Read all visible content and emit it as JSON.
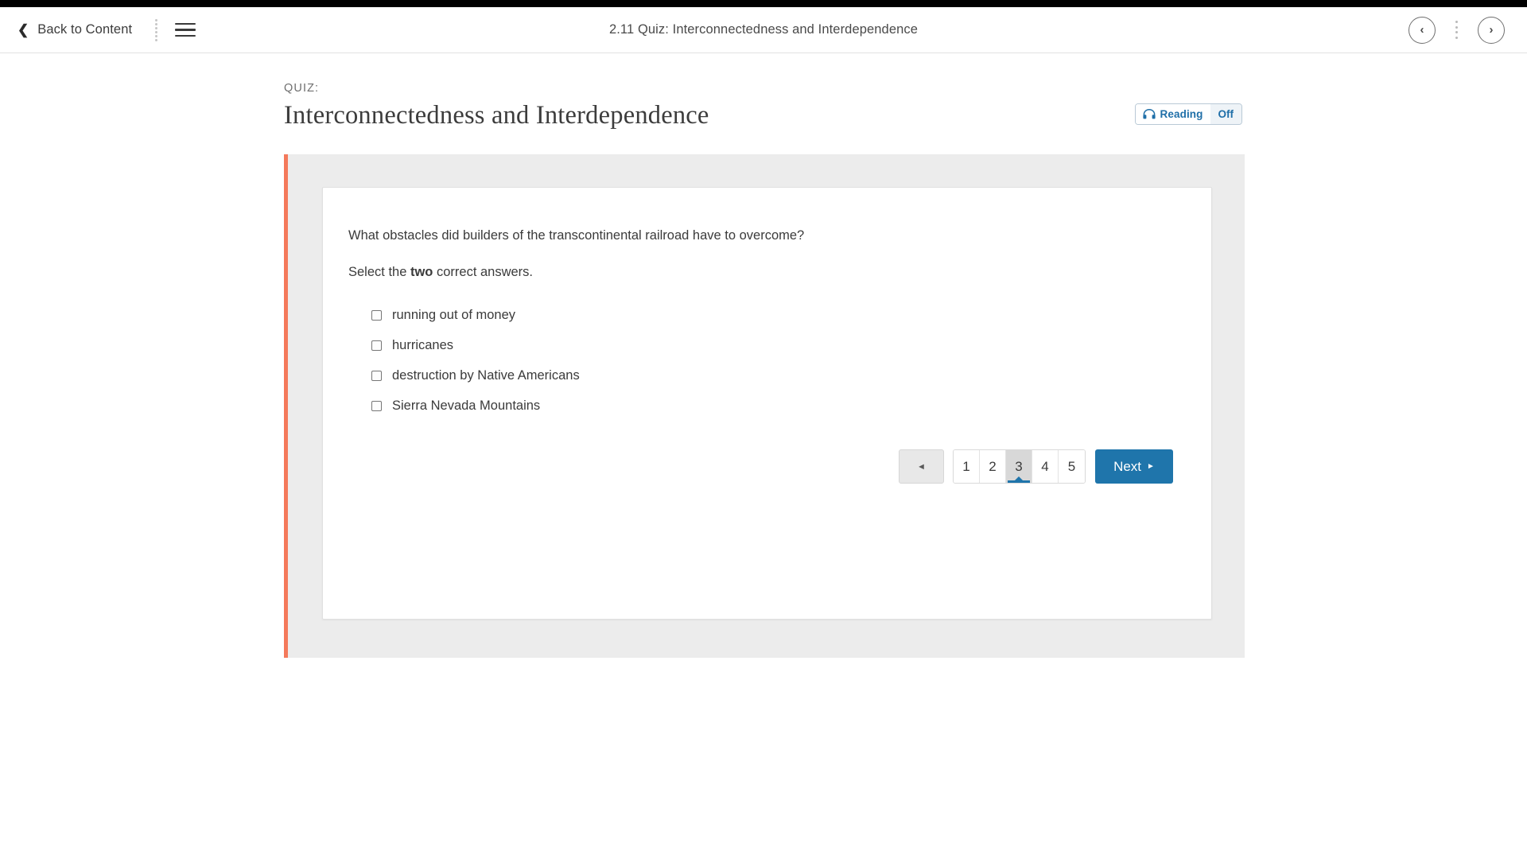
{
  "header": {
    "back_label": "Back to Content",
    "title": "2.11 Quiz: Interconnectedness and Interdependence",
    "prev_glyph": "‹",
    "next_glyph": "›"
  },
  "page": {
    "kicker": "QUIZ:",
    "title": "Interconnectedness and Interdependence",
    "reading": {
      "label": "Reading",
      "state": "Off"
    }
  },
  "question": {
    "prompt": "What obstacles did builders of the transcontinental railroad have to overcome?",
    "instruction_prefix": "Select the ",
    "instruction_bold": "two",
    "instruction_suffix": " correct answers.",
    "choices": [
      {
        "label": "running out of money",
        "checked": false
      },
      {
        "label": "hurricanes",
        "checked": false
      },
      {
        "label": "destruction by Native Americans",
        "checked": false
      },
      {
        "label": "Sierra Nevada Mountains",
        "checked": false
      }
    ]
  },
  "pagination": {
    "prev_glyph": "◄",
    "pages": [
      "1",
      "2",
      "3",
      "4",
      "5"
    ],
    "active_page": "3",
    "next_label": "Next",
    "next_glyph": "►"
  },
  "colors": {
    "accent_bar": "#f4795b",
    "primary_blue": "#1f75ab",
    "panel_gray": "#ececec",
    "active_page_gray": "#d8d8d8"
  }
}
